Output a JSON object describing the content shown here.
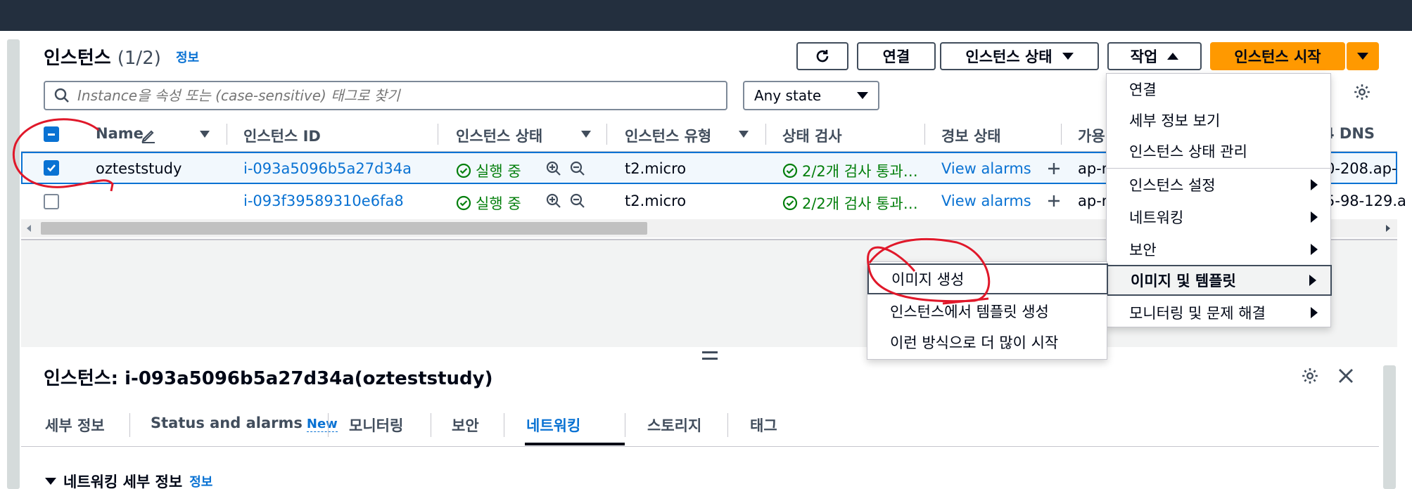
{
  "header": {
    "title": "인스턴스",
    "count": "(1/2)",
    "info_link": "정보"
  },
  "toolbar": {
    "refresh_label": "",
    "connect_label": "연결",
    "instance_state_label": "인스턴스 상태",
    "actions_label": "작업",
    "launch_label": "인스턴스 시작"
  },
  "search": {
    "placeholder": "Instance을 속성 또는 (case-sensitive) 태그로 찾기"
  },
  "state_filter": {
    "selected": "Any state"
  },
  "table": {
    "columns": {
      "name": "Name",
      "instance_id": "인스턴스 ID",
      "state": "인스턴스 상태",
      "type": "인스턴스 유형",
      "status_check": "상태 검사",
      "alarm_status": "경보 상태",
      "az": "가용",
      "dns": "4 DNS"
    },
    "rows": [
      {
        "name": "ozteststudy",
        "instance_id": "i-093a5096b5a27d34a",
        "state": "실행 중",
        "type": "t2.micro",
        "status_check": "2/2개 검사 통과…",
        "alarm": "View alarms",
        "az": "ap-n",
        "dns": "0-208.ap-"
      },
      {
        "name": "",
        "instance_id": "i-093f39589310e6fa8",
        "state": "실행 중",
        "type": "t2.micro",
        "status_check": "2/2개 검사 통과…",
        "alarm": "View alarms",
        "az": "ap-n",
        "dns": "5-98-129.a"
      }
    ]
  },
  "actions_menu": {
    "items": [
      {
        "label": "연결"
      },
      {
        "label": "세부 정보 보기"
      },
      {
        "label": "인스턴스 상태 관리"
      },
      {
        "label": "인스턴스 설정"
      },
      {
        "label": "네트워킹"
      },
      {
        "label": "보안"
      },
      {
        "label": "이미지 및 템플릿"
      },
      {
        "label": "모니터링 및 문제 해결"
      }
    ]
  },
  "image_submenu": {
    "items": [
      {
        "label": "이미지 생성"
      },
      {
        "label": "인스턴스에서 템플릿 생성"
      },
      {
        "label": "이런 방식으로 더 많이 시작"
      }
    ]
  },
  "detail": {
    "title": "인스턴스: i-093a5096b5a27d34a(ozteststudy)",
    "tabs": [
      {
        "label": "세부 정보"
      },
      {
        "label": "Status and alarms"
      },
      {
        "label": "모니터링"
      },
      {
        "label": "보안"
      },
      {
        "label": "네트워킹"
      },
      {
        "label": "스토리지"
      },
      {
        "label": "태그"
      }
    ],
    "new_badge": "New",
    "section_title": "네트워킹 세부 정보",
    "section_info": "정보"
  },
  "colors": {
    "topbar": "#232f3e",
    "primary": "#ff9900",
    "link": "#0972d3",
    "success": "#037f0c",
    "annotation": "#e0182a"
  }
}
